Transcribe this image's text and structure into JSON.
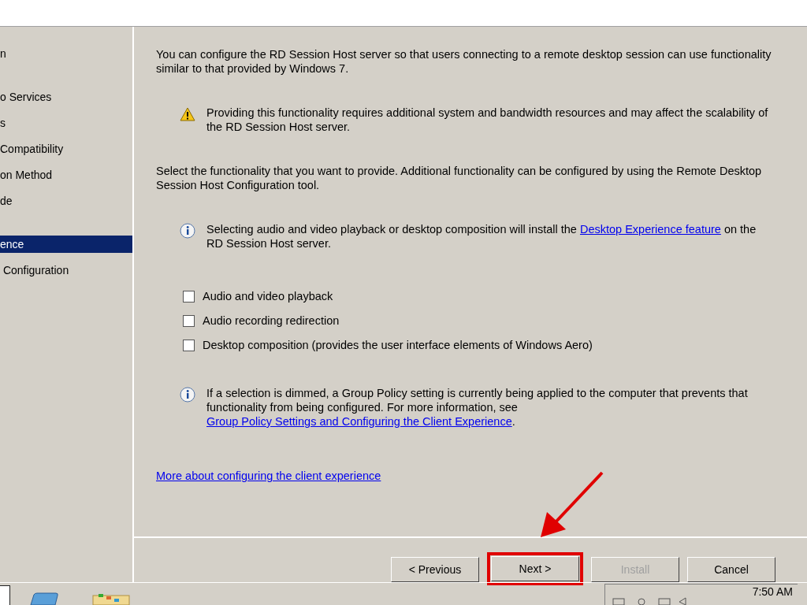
{
  "sidebar": {
    "items": [
      {
        "label": "n",
        "selected": false
      },
      {
        "label": "o Services",
        "selected": false
      },
      {
        "label": "s",
        "selected": false
      },
      {
        "label": "Compatibility",
        "selected": false
      },
      {
        "label": "on Method",
        "selected": false
      },
      {
        "label": "de",
        "selected": false
      },
      {
        "label": "ence",
        "selected": true
      },
      {
        "label": " Configuration",
        "selected": false
      }
    ]
  },
  "intro": "You can configure the RD Session Host server so that users connecting to a remote desktop session can use functionality similar to that provided by Windows 7.",
  "warning": "Providing this functionality requires additional system and bandwidth resources and may affect the scalability of the RD Session Host server.",
  "instruction": "Select the functionality that you want to provide. Additional functionality can be configured by using the Remote Desktop Session Host Configuration tool.",
  "notes": [
    {
      "before": "Selecting audio and video playback or desktop composition will install the ",
      "link": "Desktop Experience feature",
      "after": " on the RD Session Host server."
    },
    {
      "before": "If a selection is dimmed, a Group Policy setting is currently being applied to the computer that prevents that functionality from being configured. For more information, see ",
      "link": "Group Policy Settings and Configuring the Client Experience",
      "after": "."
    }
  ],
  "options": [
    {
      "label": "Audio and video playback",
      "checked": false
    },
    {
      "label": "Audio recording redirection",
      "checked": false
    },
    {
      "label": "Desktop composition (provides the user interface elements of Windows Aero)",
      "checked": false
    }
  ],
  "more_link": "More about configuring the client experience",
  "buttons": [
    {
      "label": "< Previous",
      "disabled": false,
      "highlighted": false
    },
    {
      "label": "Next >",
      "disabled": false,
      "highlighted": true
    },
    {
      "label": "Install",
      "disabled": true,
      "highlighted": false
    },
    {
      "label": "Cancel",
      "disabled": false,
      "highlighted": false
    }
  ],
  "taskbar": {
    "clock": "7:50 AM"
  }
}
